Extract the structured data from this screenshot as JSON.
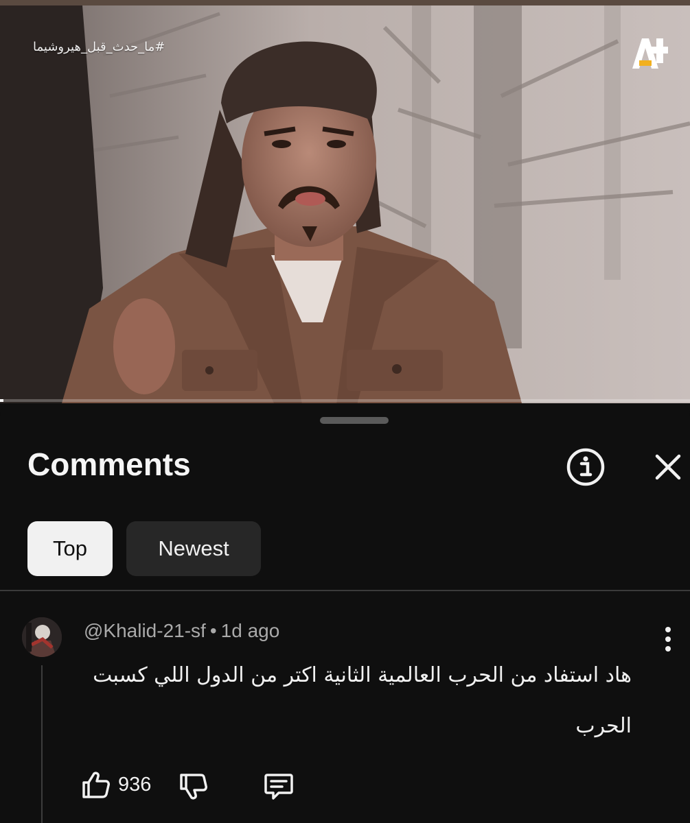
{
  "video": {
    "hashtag": "#ما_حدث_قبل_هيروشيما",
    "channel_logo_icon": "aj-plus-logo-icon",
    "progress": 0.005
  },
  "comments_sheet": {
    "title": "Comments",
    "info_icon": "info-icon",
    "close_icon": "close-icon",
    "filters": [
      {
        "label": "Top",
        "selected": true
      },
      {
        "label": "Newest",
        "selected": false
      }
    ]
  },
  "comments": [
    {
      "author": "@Khalid-21-sf",
      "time": "1d ago",
      "text": "هاد استفاد من الحرب العالمية الثانية اكتر من الدول اللي كسبت الحرب",
      "likes": "936"
    }
  ],
  "colors": {
    "background": "#0f0f0f",
    "chip_selected": "#f1f1f1",
    "chip_unselected": "#272727",
    "meta_text": "#aaaaaa"
  }
}
